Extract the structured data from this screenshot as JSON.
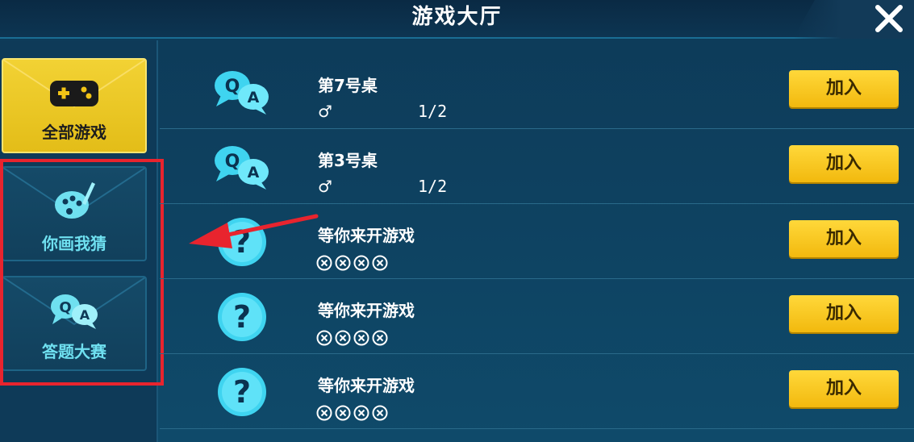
{
  "header": {
    "title": "游戏大厅",
    "close_icon": "close-icon"
  },
  "sidebar": {
    "items": [
      {
        "label": "全部游戏",
        "icon": "gamepad-icon",
        "active": true
      },
      {
        "label": "你画我猜",
        "icon": "paint-palette-icon",
        "active": false
      },
      {
        "label": "答题大赛",
        "icon": "qa-bubble-icon",
        "active": false
      }
    ]
  },
  "rows": [
    {
      "title": "第7号桌",
      "icon": "qa-bubble-icon",
      "gender": "♂",
      "count": "1/2",
      "button": "加入"
    },
    {
      "title": "第3号桌",
      "icon": "qa-bubble-icon",
      "gender": "♂",
      "count": "1/2",
      "button": "加入"
    },
    {
      "title": "等你来开游戏",
      "icon": "question-icon",
      "slots": 4,
      "button": "加入"
    },
    {
      "title": "等你来开游戏",
      "icon": "question-icon",
      "slots": 4,
      "button": "加入"
    },
    {
      "title": "等你来开游戏",
      "icon": "question-icon",
      "slots": 4,
      "button": "加入"
    }
  ],
  "colors": {
    "accent_yellow": "#f2c416",
    "highlight_red": "#e8242e",
    "label_cyan": "#6fe0f0"
  }
}
